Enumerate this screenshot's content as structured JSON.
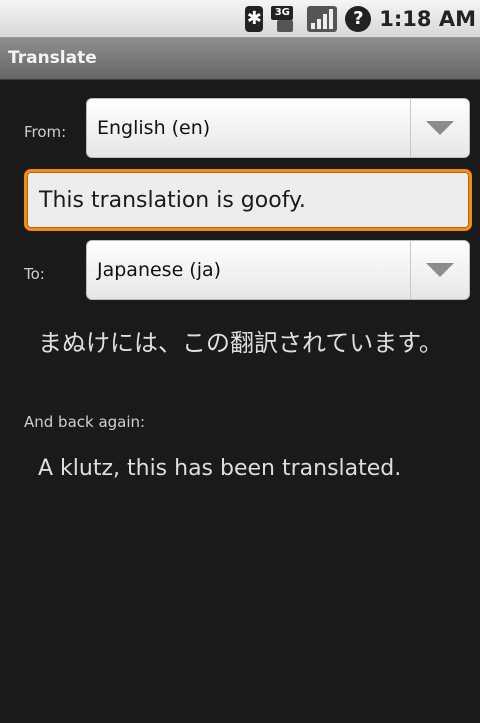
{
  "status_bar": {
    "time": "1:18 AM",
    "bluetooth_glyph": "✱",
    "network_label": "3G",
    "help_glyph": "?"
  },
  "title_bar": {
    "title": "Translate"
  },
  "from": {
    "label": "From:",
    "selected": "English (en)"
  },
  "input": {
    "value": "This translation is goofy."
  },
  "to": {
    "label": "To:",
    "selected": "Japanese (ja)"
  },
  "translation": {
    "text": "まぬけには、この翻訳されています。"
  },
  "back": {
    "label": "And back again:",
    "text": "A klutz, this has been translated."
  },
  "icons": {
    "bluetooth": "bluetooth-icon",
    "network": "3g-data-icon",
    "signal": "signal-strength-icon",
    "help": "question-icon",
    "dropdown": "dropdown-triangle-icon"
  }
}
